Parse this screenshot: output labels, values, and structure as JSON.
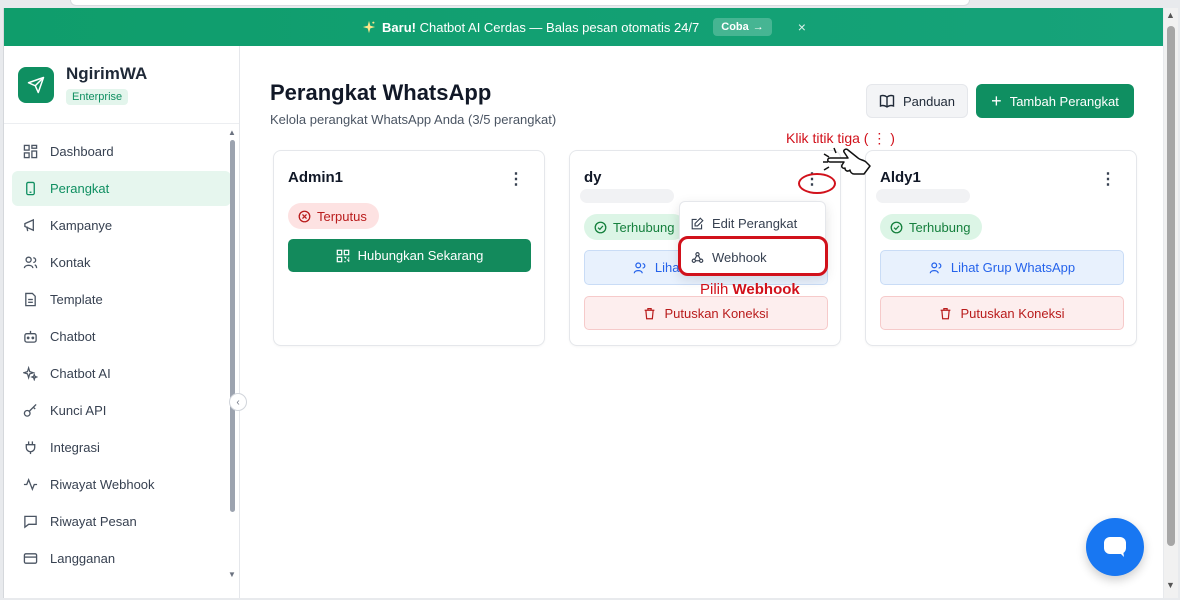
{
  "banner": {
    "prefix": "Baru!",
    "message": " Chatbot AI Cerdas — Balas pesan otomatis 24/7",
    "cta": "Coba",
    "close": "×"
  },
  "brand": {
    "name": "NgirimWA",
    "badge": "Enterprise"
  },
  "sidebar": {
    "items": [
      {
        "label": "Dashboard",
        "icon": "grid-icon"
      },
      {
        "label": "Perangkat",
        "icon": "phone-icon",
        "active": true
      },
      {
        "label": "Kampanye",
        "icon": "megaphone-icon"
      },
      {
        "label": "Kontak",
        "icon": "users-icon"
      },
      {
        "label": "Template",
        "icon": "document-icon"
      },
      {
        "label": "Chatbot",
        "icon": "bot-icon"
      },
      {
        "label": "Chatbot AI",
        "icon": "sparkles-icon"
      },
      {
        "label": "Kunci API",
        "icon": "key-icon"
      },
      {
        "label": "Integrasi",
        "icon": "plug-icon"
      },
      {
        "label": "Riwayat Webhook",
        "icon": "activity-icon"
      },
      {
        "label": "Riwayat Pesan",
        "icon": "message-icon"
      },
      {
        "label": "Langganan",
        "icon": "card-icon"
      }
    ]
  },
  "page": {
    "title": "Perangkat WhatsApp",
    "subtitle": "Kelola perangkat WhatsApp Anda (3/5 perangkat)",
    "guide_label": "Panduan",
    "add_label": "Tambah Perangkat"
  },
  "devices": [
    {
      "name": "Admin1",
      "status": "Terputus",
      "action": "Hubungkan Sekarang"
    },
    {
      "name": "dy",
      "status": "Terhubung",
      "groups": "Lihat Grup WhatsApp",
      "disconnect": "Putuskan Koneksi"
    },
    {
      "name": "Aldy1",
      "status": "Terhubung",
      "groups": "Lihat Grup WhatsApp",
      "disconnect": "Putuskan Koneksi"
    }
  ],
  "menu": {
    "edit": "Edit Perangkat",
    "webhook": "Webhook"
  },
  "annotations": {
    "click_dots": "Klik titik tiga ( ⋮ )",
    "pick_prefix": "Pilih ",
    "pick_bold": "Webhook"
  },
  "colors": {
    "brand": "#0f8f61",
    "danger": "#b91c1c",
    "annotation": "#d1111b",
    "info": "#2563eb"
  }
}
